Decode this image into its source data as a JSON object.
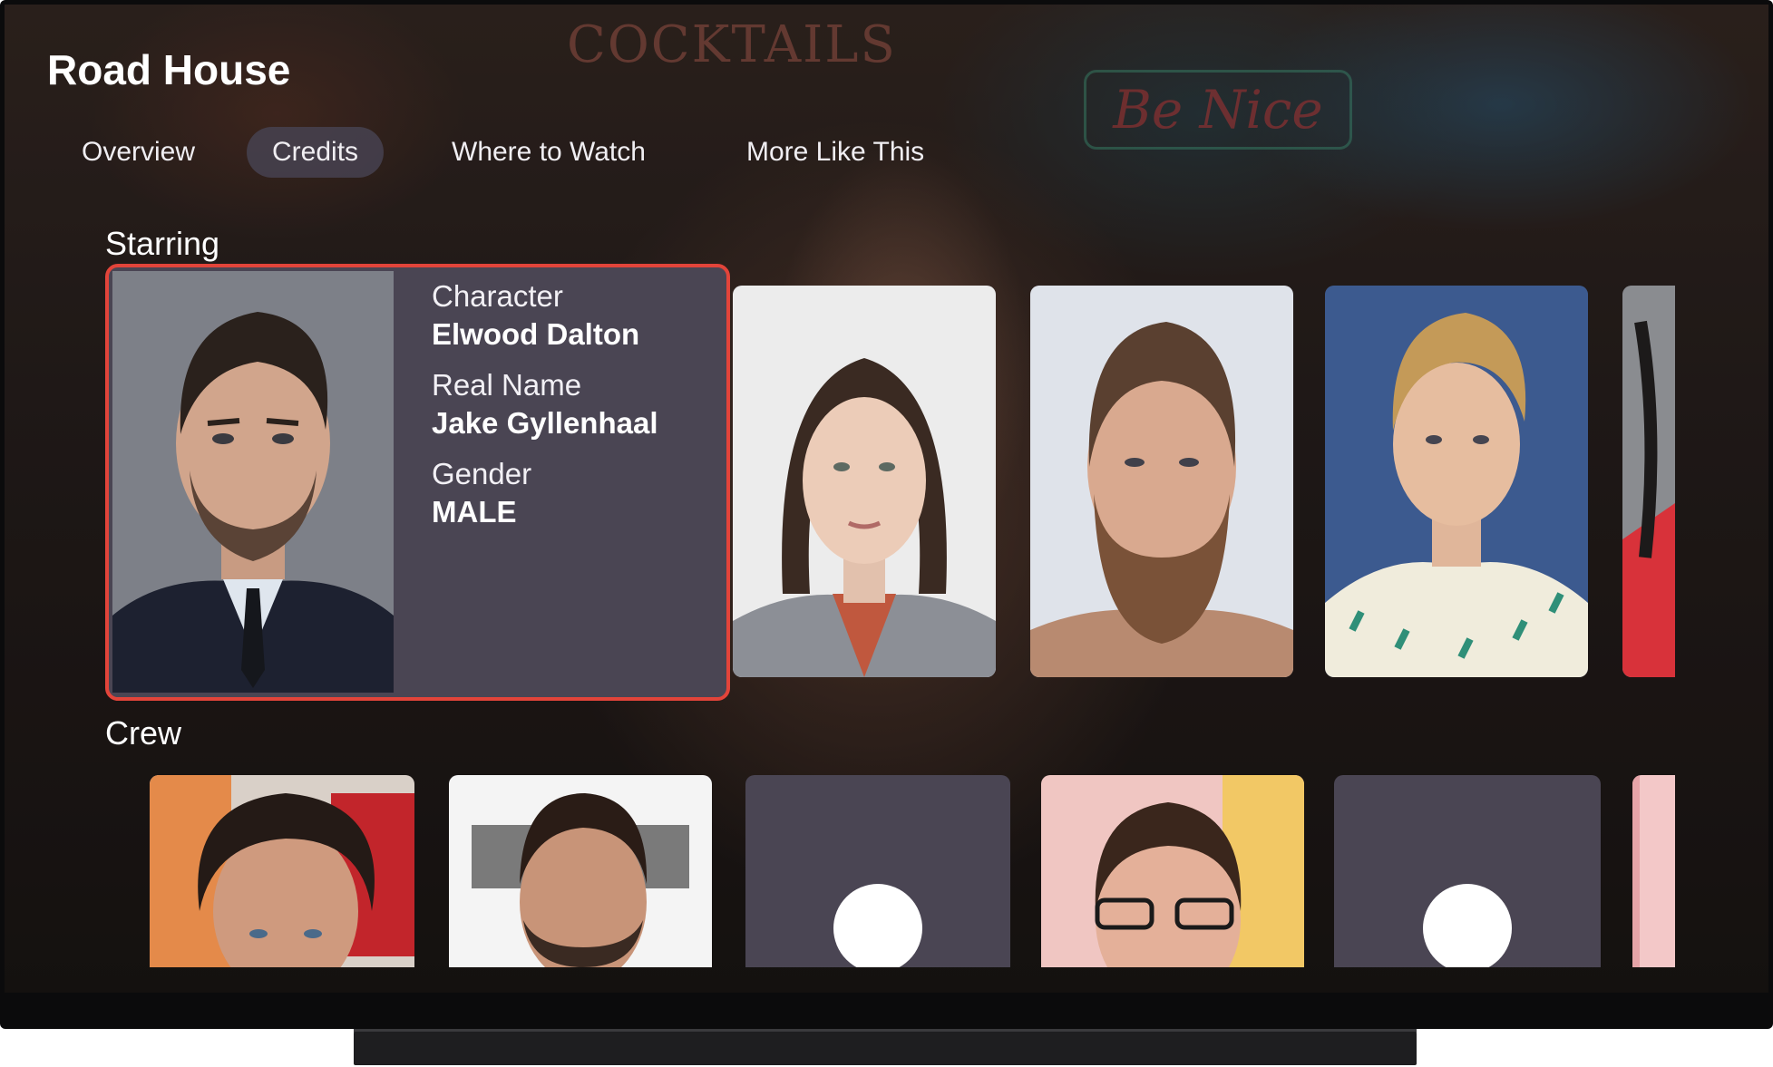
{
  "page": {
    "title": "Road House",
    "background_signs": [
      "COCKTAILS",
      "Be Nice"
    ]
  },
  "tabs": [
    {
      "label": "Overview",
      "active": false
    },
    {
      "label": "Credits",
      "active": true
    },
    {
      "label": "Where to Watch",
      "active": false
    },
    {
      "label": "More Like This",
      "active": false
    }
  ],
  "starring": {
    "title": "Starring",
    "focused": {
      "character_label": "Character",
      "character": "Elwood Dalton",
      "real_name_label": "Real Name",
      "real_name": "Jake Gyllenhaal",
      "gender_label": "Gender",
      "gender": "MALE"
    },
    "cards": [
      "woman-portrait",
      "bearded-man-portrait",
      "blond-man-portrait",
      "partial-portrait"
    ]
  },
  "crew": {
    "title": "Crew",
    "cards": [
      "curly-hair-man-portrait",
      "bearded-man-portrait",
      "placeholder",
      "glasses-man-portrait",
      "placeholder",
      "partial-portrait"
    ]
  },
  "colors": {
    "focus_border": "#e2443a",
    "card_bg": "#4a4553",
    "tab_active_bg": "#46424f",
    "text": "#ffffff"
  }
}
